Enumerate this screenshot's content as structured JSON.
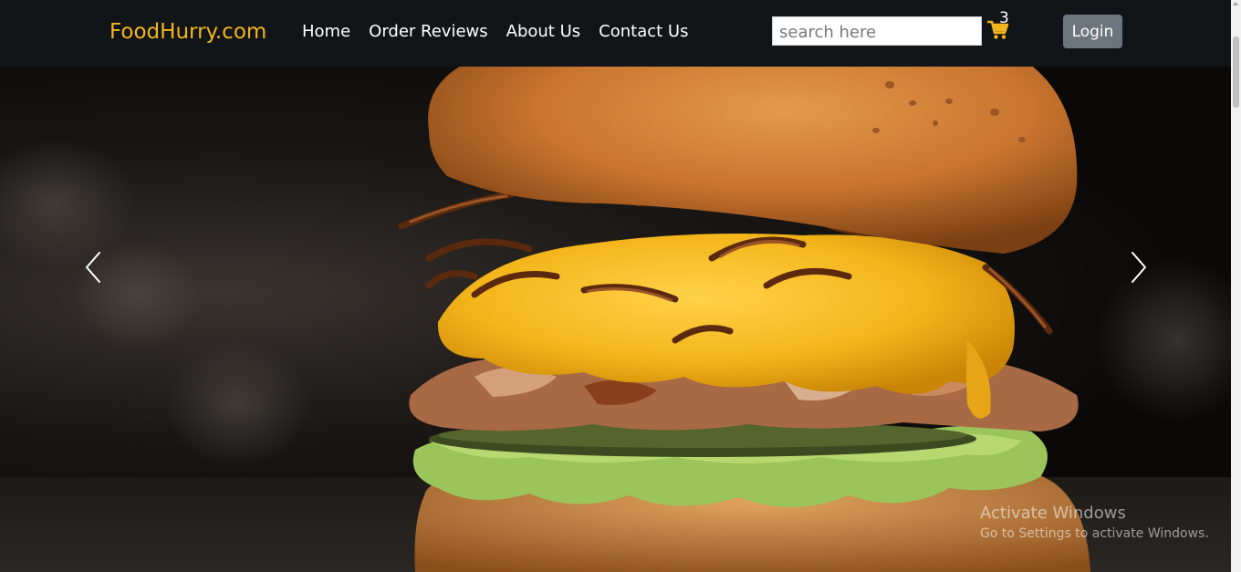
{
  "navbar": {
    "brand": "FoodHurry.com",
    "links": [
      {
        "label": "Home"
      },
      {
        "label": "Order Reviews"
      },
      {
        "label": "About Us"
      },
      {
        "label": "Contact Us"
      }
    ],
    "search": {
      "placeholder": "search here",
      "value": ""
    },
    "cart": {
      "count": "3",
      "icon": "shopping-cart-icon"
    },
    "login_label": "Login"
  },
  "colors": {
    "brand": "#f2b51c",
    "navbar_bg": "#121518",
    "cart_icon": "#f2b51c",
    "login_bg": "#6c757d"
  },
  "carousel": {
    "prev_icon": "chevron-left-icon",
    "next_icon": "chevron-right-icon",
    "image": "burger-photo"
  },
  "watermark": {
    "title": "Activate Windows",
    "subtitle": "Go to Settings to activate Windows."
  }
}
